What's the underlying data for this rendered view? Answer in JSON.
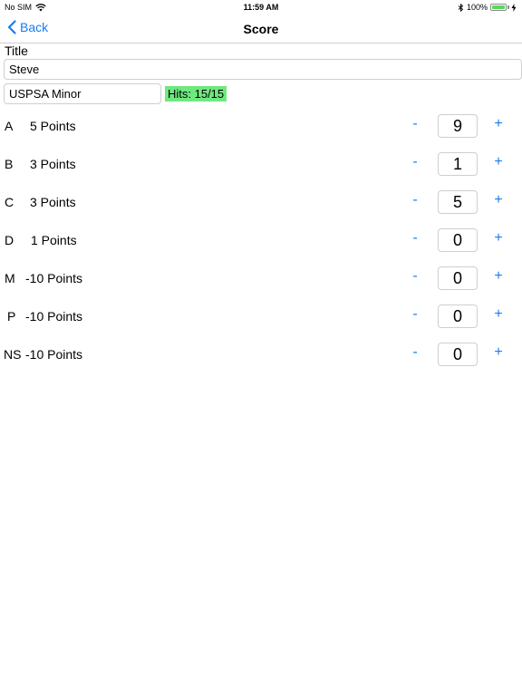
{
  "status": {
    "carrier": "No SIM",
    "time": "11:59 AM",
    "battery": "100%"
  },
  "nav": {
    "back_label": "Back",
    "title": "Score"
  },
  "form": {
    "title_label": "Title",
    "title_value": "Steve",
    "division_value": "USPSA Minor",
    "hits": "Hits: 15/15"
  },
  "rows": [
    {
      "zone": "A",
      "points": "5 Points",
      "count": "9"
    },
    {
      "zone": "B",
      "points": "3 Points",
      "count": "1"
    },
    {
      "zone": "C",
      "points": "3 Points",
      "count": "5"
    },
    {
      "zone": "D",
      "points": "1 Points",
      "count": "0"
    },
    {
      "zone": "M",
      "points": "-10 Points",
      "count": "0"
    },
    {
      "zone": "P",
      "points": "-10 Points",
      "count": "0"
    },
    {
      "zone": "NS",
      "points": "-10 Points",
      "count": "0"
    }
  ],
  "controls": {
    "minus": "-",
    "plus": "+"
  },
  "colors": {
    "accent": "#1a7cf0",
    "hits_badge": "#6fe87f",
    "battery": "#5ad65a"
  },
  "icons": {
    "back": "chevron-left-icon",
    "wifi": "wifi-icon",
    "bluetooth": "bluetooth-icon",
    "battery": "battery-icon",
    "charging": "charging-bolt-icon"
  }
}
